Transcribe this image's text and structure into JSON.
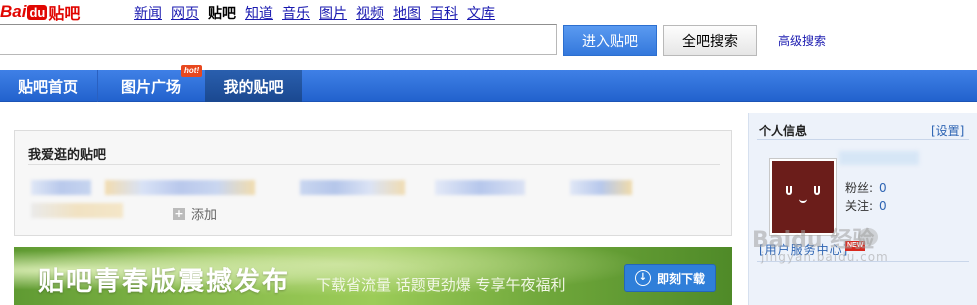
{
  "logo": {
    "part1": "Bai",
    "part2": "du",
    "part3": "贴吧"
  },
  "topnav": [
    "新闻",
    "网页",
    "贴吧",
    "知道",
    "音乐",
    "图片",
    "视频",
    "地图",
    "百科",
    "文库"
  ],
  "search": {
    "placeholder": "",
    "enter_label": "进入贴吧",
    "all_label": "全吧搜索",
    "advanced_label": "高级搜索"
  },
  "tabs": {
    "home": "贴吧首页",
    "pics": "图片广场",
    "mine": "我的贴吧",
    "hot": "hot!"
  },
  "favorites": {
    "title": "我爱逛的贴吧",
    "add_label": "添加"
  },
  "banner": {
    "title": "贴吧青春版震撼发布",
    "subtitle": "下载省流量 话题更劲爆 专享午夜福利",
    "button": "即刻下载"
  },
  "profile": {
    "title": "个人信息",
    "settings": "[设置]",
    "fans_label": "粉丝:",
    "fans_value": "0",
    "follow_label": "关注:",
    "follow_value": "0",
    "member_link": "[用户服务中心]",
    "new_badge": "NEW"
  },
  "watermark": {
    "text": "Baidu 经验",
    "url": "jingyan.baidu.com"
  },
  "colors": {
    "brand_red": "#e10601",
    "tab_blue": "#2e6fd8",
    "link_blue": "#2d64b3"
  }
}
